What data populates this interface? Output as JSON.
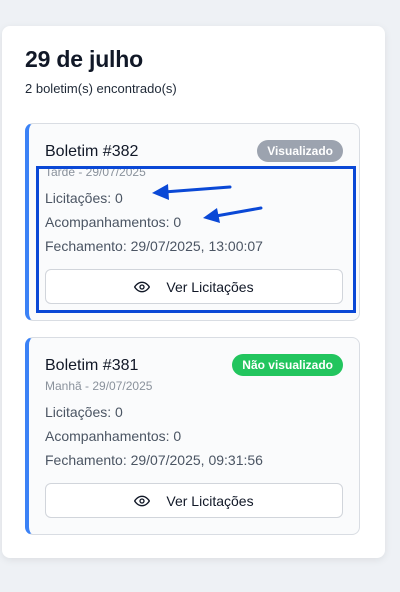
{
  "header": {
    "date": "29 de julho",
    "count": "2 boletim(s) encontrado(s)"
  },
  "bulletins": [
    {
      "title": "Boletim #382",
      "subtitle": "Tarde - 29/07/2025",
      "status": "Visualizado",
      "bids": "Licitações: 0",
      "followups": "Acompanhamentos: 0",
      "closing": "Fechamento: 29/07/2025, 13:00:07",
      "button": "Ver Licitações"
    },
    {
      "title": "Boletim #381",
      "subtitle": "Manhã - 29/07/2025",
      "status": "Não visualizado",
      "bids": "Licitações: 0",
      "followups": "Acompanhamentos: 0",
      "closing": "Fechamento: 29/07/2025, 09:31:56",
      "button": "Ver Licitações"
    }
  ],
  "colors": {
    "accent": "#3b82f6",
    "badge_seen": "#9ca3af",
    "badge_unseen": "#22c55e",
    "annotation": "#0a48d6"
  },
  "icons": {
    "view_button": "eye-icon",
    "annotation": "arrow-icon"
  }
}
